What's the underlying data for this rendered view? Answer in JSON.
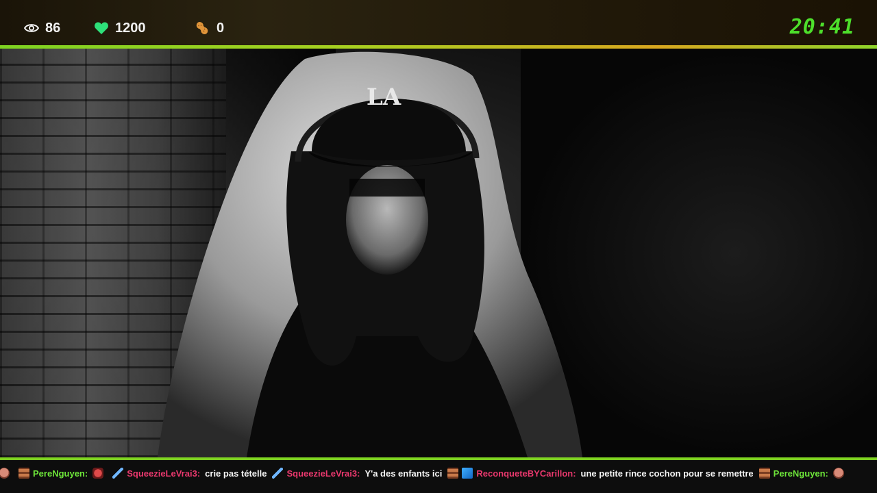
{
  "stats": {
    "viewers": "86",
    "likes": "1200",
    "peanuts": "0",
    "clock": "20:41"
  },
  "icons": {
    "viewers": "eye-icon",
    "likes": "heart-icon",
    "peanuts": "peanut-icon"
  },
  "colors": {
    "accent_green": "#7ed321",
    "clock_green": "#4ddf2b",
    "heart_green": "#2ee07a",
    "peanut_orange": "#e0953a",
    "username_green": "#6ee63a",
    "username_red": "#e8386d"
  },
  "video": {
    "cap_logo": "LA"
  },
  "chat": [
    {
      "emoji": "face-emoji",
      "user": "",
      "text": ""
    },
    {
      "emoji": "brick-emoji",
      "user": "PereNguyen:",
      "user_color": "green",
      "text": ""
    },
    {
      "emoji": "mask-emoji",
      "user": "",
      "text": ""
    },
    {
      "emoji": "sword-emoji",
      "user": "SqueezieLeVrai3:",
      "user_color": "red",
      "text": "crie pas tételle"
    },
    {
      "emoji": "sword-emoji",
      "user": "SqueezieLeVrai3:",
      "user_color": "red",
      "text": "Y'a des enfants ici"
    },
    {
      "emoji": "brick-emoji",
      "user": "",
      "text": ""
    },
    {
      "emoji": "cube-emoji",
      "user": "ReconqueteBYCarillon:",
      "user_color": "red",
      "text": "une petite rince cochon pour se remettre"
    },
    {
      "emoji": "brick-emoji",
      "user": "PereNguyen:",
      "user_color": "green",
      "text": ""
    },
    {
      "emoji": "face-emoji",
      "user": "",
      "text": ""
    }
  ]
}
